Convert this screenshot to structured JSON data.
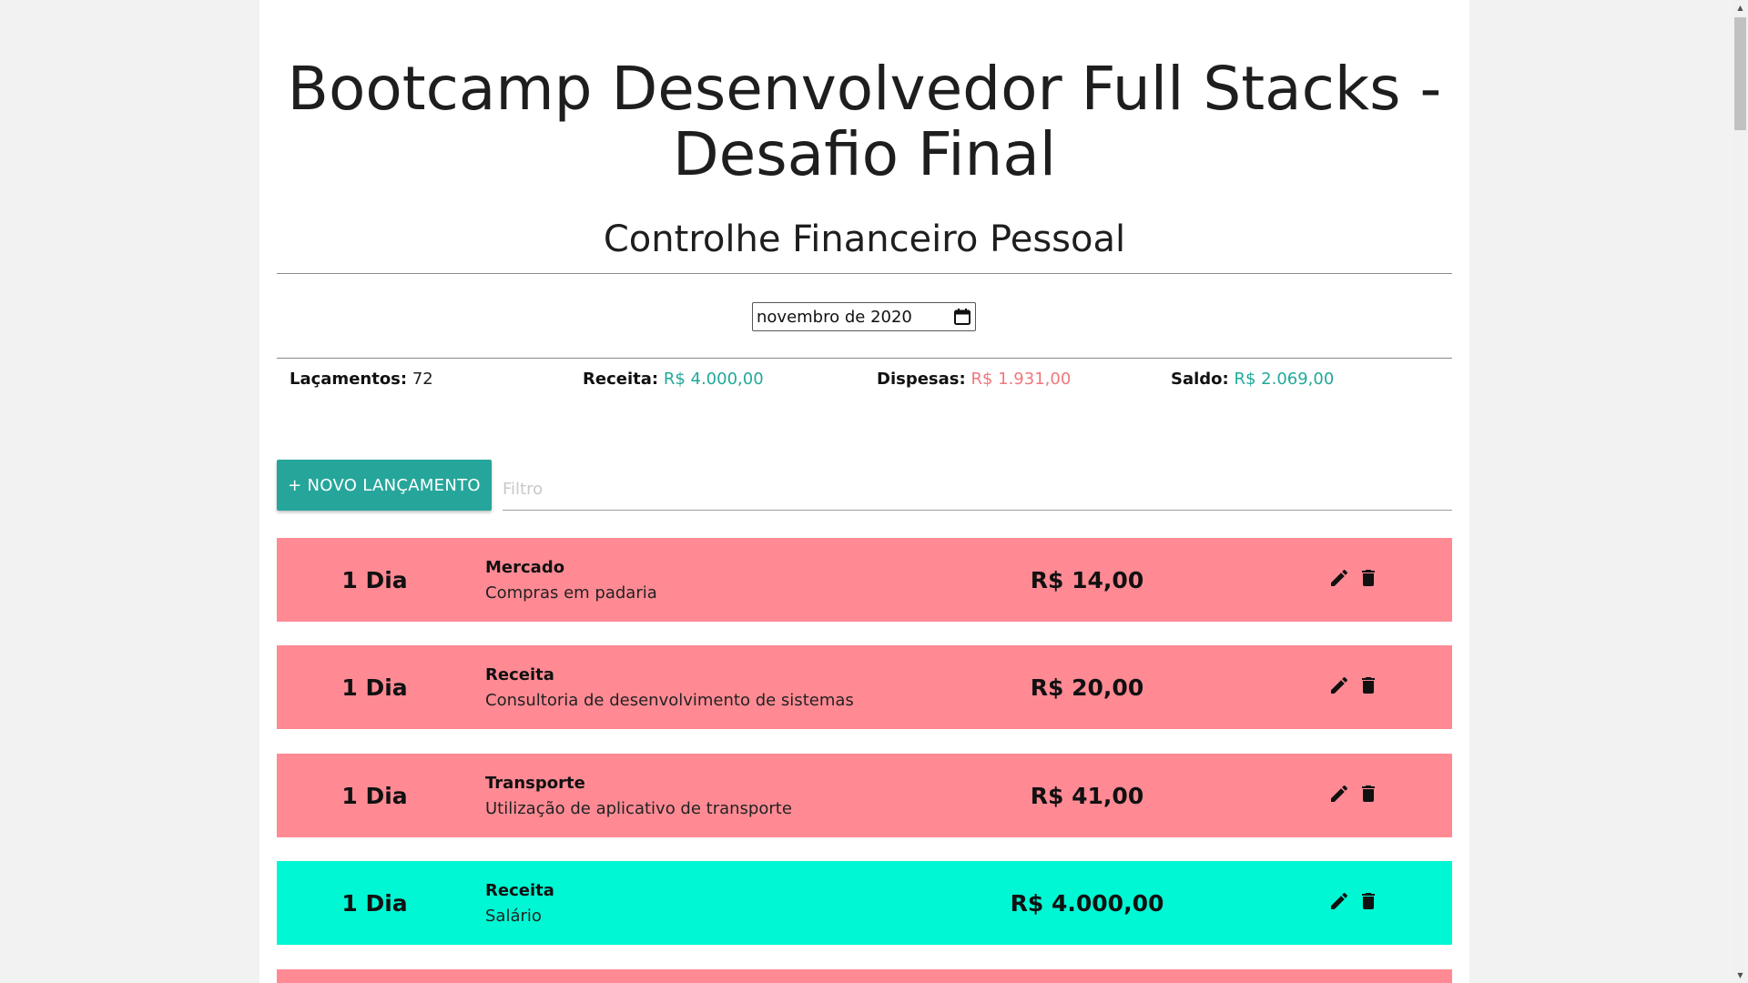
{
  "header": {
    "title": "Bootcamp Desenvolvedor Full Stacks - Desafio Final",
    "subtitle": "Controlhe Financeiro Pessoal"
  },
  "period": {
    "value": "novembro de 2020"
  },
  "summary": {
    "launches_label": "Laçamentos:",
    "launches_value": "72",
    "income_label": "Receita:",
    "income_value": "R$ 4.000,00",
    "expenses_label": "Dispesas:",
    "expenses_value": "R$ 1.931,00",
    "balance_label": "Saldo:",
    "balance_value": "R$ 2.069,00"
  },
  "actions": {
    "new_label": "+ NOVO LANÇAMENTO",
    "filter_placeholder": "Filtro"
  },
  "transactions": [
    {
      "day": "1 Dia",
      "category": "Mercado",
      "description": "Compras em padaria",
      "amount": "R$ 14,00",
      "type": "expense"
    },
    {
      "day": "1 Dia",
      "category": "Receita",
      "description": "Consultoria de desenvolvimento de sistemas",
      "amount": "R$ 20,00",
      "type": "expense"
    },
    {
      "day": "1 Dia",
      "category": "Transporte",
      "description": "Utilização de aplicativo de transporte",
      "amount": "R$ 41,00",
      "type": "expense"
    },
    {
      "day": "1 Dia",
      "category": "Receita",
      "description": "Salário",
      "amount": "R$ 4.000,00",
      "type": "income"
    }
  ],
  "colors": {
    "expense_row": "#ff8a94",
    "income_row": "#00f7d4",
    "positive_text": "#22a99b",
    "negative_text": "#f0777c",
    "primary_button": "#26a69a"
  },
  "icons": {
    "period": "calendar-icon",
    "edit": "pencil-icon",
    "delete": "trash-icon"
  }
}
